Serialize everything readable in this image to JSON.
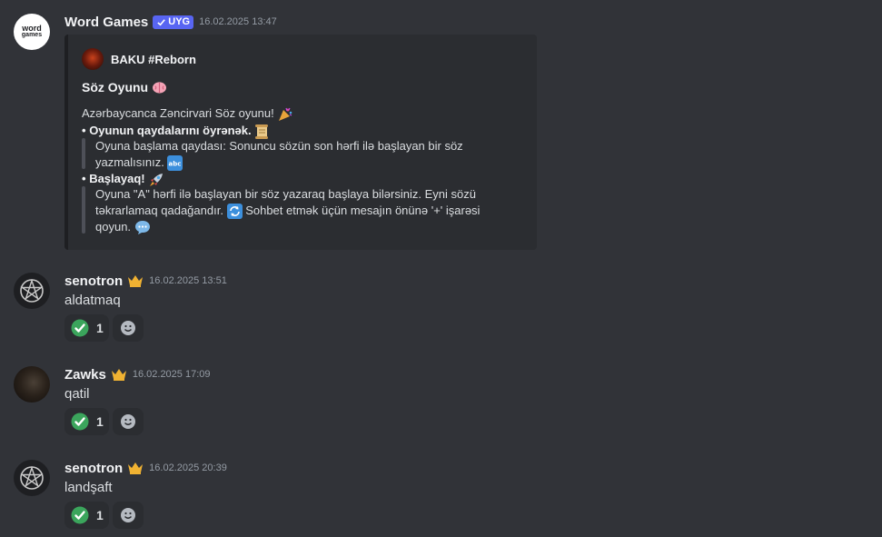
{
  "messages": [
    {
      "author": "Word Games",
      "badge": "UYG",
      "timestamp": "16.02.2025 13:47",
      "avatar": {
        "line1": "word",
        "line2": "games"
      },
      "embed": {
        "author": "BAKU #Reborn",
        "title": "Söz Oyunu",
        "intro": "Azərbaycanca Zəncirvari Söz oyunu!",
        "bullet1_title": "Oyunun qaydalarını öyrənək.",
        "bullet1_text_line1": "Oyuna başlama qaydası: Sonuncu sözün son hərfi ilə başlayan bir söz",
        "bullet1_text_line2": "yazmalısınız.",
        "bullet2_title": "Başlayaq!",
        "bullet2_text_line1": "Oyuna \"A\" hərfi ilə başlayan bir söz yazaraq başlaya bilərsiniz. Eyni sözü",
        "bullet2_text_line2": "təkrarlamaq qadağandır.",
        "bullet2_text_line2b": "Sohbet etmək üçün mesajın önünə '+' işarəsi",
        "bullet2_text_line3": "qoyun."
      }
    },
    {
      "author": "senotron",
      "timestamp": "16.02.2025 13:51",
      "content": "aldatmaq",
      "reaction_count": "1"
    },
    {
      "author": "Zawks",
      "timestamp": "16.02.2025 17:09",
      "content": "qatil",
      "reaction_count": "1"
    },
    {
      "author": "senotron",
      "timestamp": "16.02.2025 20:39",
      "content": "landşaft",
      "reaction_count": "1"
    }
  ],
  "icons": {
    "verified": "check-icon",
    "crown": "crown-icon",
    "brain": "brain-emoji",
    "party": "party-popper-emoji",
    "scroll": "scroll-emoji",
    "abc": "abc-emoji",
    "rocket": "rocket-emoji",
    "repeat": "repeat-emoji",
    "speech": "speech-bubble-emoji",
    "check_reaction": "check-mark-button-emoji",
    "add_reaction": "add-reaction-icon"
  },
  "colors": {
    "background": "#313338",
    "embed_bg": "#2b2d31",
    "badge": "#5865f2",
    "crown": "#f0b232",
    "check": "#3ba55c"
  }
}
